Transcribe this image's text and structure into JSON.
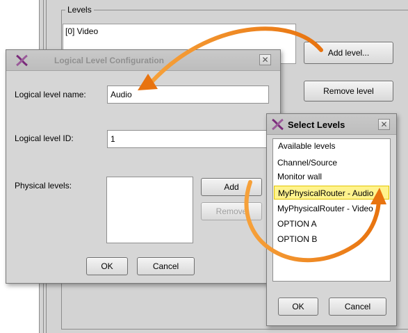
{
  "main_window": {
    "levels_group_label": "Levels",
    "levels": [
      "[0] Video"
    ],
    "add_level_button": "Add level...",
    "remove_level_button": "Remove level"
  },
  "logical_dialog": {
    "title": "Logical Level Configuration",
    "name_label": "Logical level name:",
    "name_value": "Audio",
    "id_label": "Logical level ID:",
    "id_value": "1",
    "physical_label": "Physical levels:",
    "add_button": "Add",
    "remove_button": "Remove",
    "ok_button": "OK",
    "cancel_button": "Cancel"
  },
  "select_dialog": {
    "title": "Select Levels",
    "group_label": "Available levels",
    "items": [
      {
        "label": "Channel/Source",
        "selected": false
      },
      {
        "label": "Monitor wall",
        "selected": false
      },
      {
        "label": "MyPhysicalRouter - Audio",
        "selected": true
      },
      {
        "label": "MyPhysicalRouter - Video",
        "selected": false
      },
      {
        "label": "OPTION A",
        "selected": false
      },
      {
        "label": "OPTION B",
        "selected": false
      }
    ],
    "ok_button": "OK",
    "cancel_button": "Cancel"
  },
  "colors": {
    "window_bg": "#d3d3d3",
    "selection_bg": "#fff38d",
    "annotation_arrow": "#f08a1c",
    "logo": "#7a2a7a"
  },
  "icons": {
    "app_logo": "x-logo-icon",
    "close": "close-icon",
    "arrow": "curved-arrow"
  }
}
